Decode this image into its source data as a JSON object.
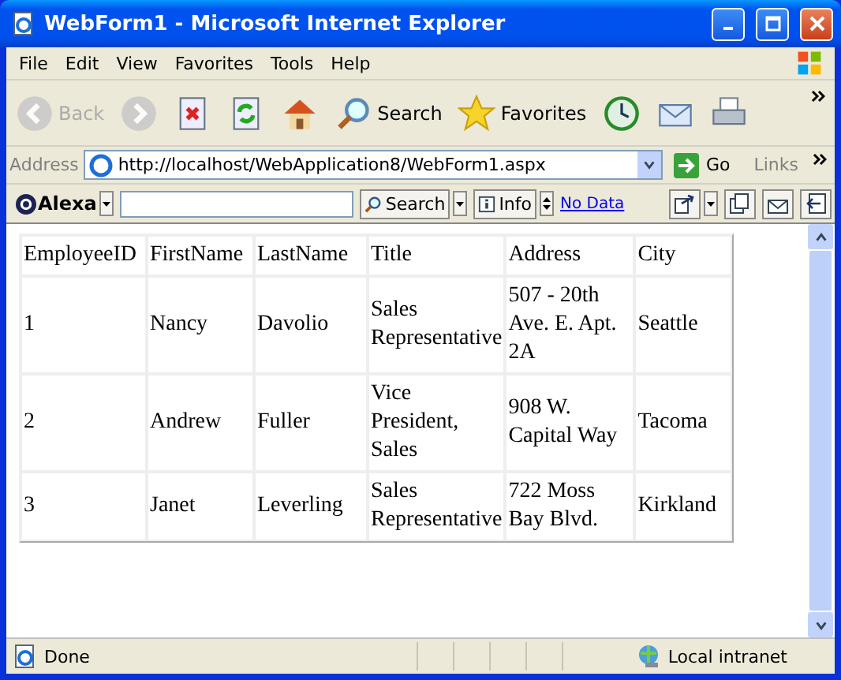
{
  "window": {
    "title": "WebForm1 - Microsoft Internet Explorer"
  },
  "menu": [
    "File",
    "Edit",
    "View",
    "Favorites",
    "Tools",
    "Help"
  ],
  "toolbar": [
    {
      "kind": "back",
      "label": "Back",
      "disabled": true
    },
    {
      "kind": "forward",
      "disabled": true
    },
    {
      "kind": "stop",
      "disabled": false
    },
    {
      "kind": "refresh",
      "disabled": false
    },
    {
      "kind": "home",
      "disabled": false
    },
    {
      "kind": "search",
      "label": "Search",
      "disabled": false
    },
    {
      "kind": "favorites",
      "label": "Favorites",
      "disabled": false
    },
    {
      "kind": "history",
      "disabled": false
    },
    {
      "kind": "mail",
      "disabled": false
    },
    {
      "kind": "print",
      "disabled": false
    }
  ],
  "address_bar": {
    "label": "Address",
    "value": "http://localhost/WebApplication8/WebForm1.aspx",
    "go": "Go",
    "links": "Links"
  },
  "alexa_bar": {
    "logo": "Alexa",
    "search": "Search",
    "info": "Info",
    "link": "No Data"
  },
  "table": {
    "columns": [
      "EmployeeID",
      "FirstName",
      "LastName",
      "Title",
      "Address",
      "City"
    ],
    "rows": [
      [
        "1",
        "Nancy",
        "Davolio",
        "Sales Representative",
        "507 - 20th Ave. E. Apt. 2A",
        "Seattle"
      ],
      [
        "2",
        "Andrew",
        "Fuller",
        "Vice President, Sales",
        "908 W. Capital Way",
        "Tacoma"
      ],
      [
        "3",
        "Janet",
        "Leverling",
        "Sales Representative",
        "722 Moss Bay Blvd.",
        "Kirkland"
      ]
    ]
  },
  "status_bar": {
    "text": "Done",
    "zone": "Local intranet"
  }
}
